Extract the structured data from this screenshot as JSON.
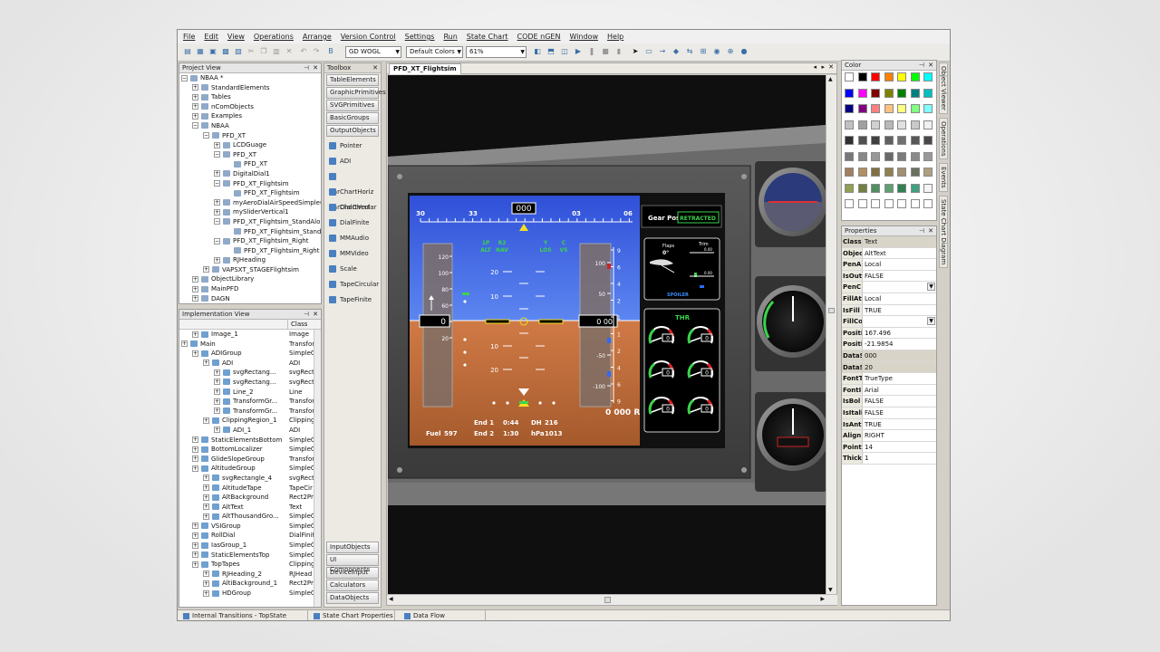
{
  "menu": [
    "File",
    "Edit",
    "View",
    "Operations",
    "Arrange",
    "Version Control",
    "Settings",
    "Run",
    "State Chart",
    "CODE nGEN",
    "Window",
    "Help"
  ],
  "toolbar": {
    "font_select": "GD WOGL",
    "colors_select": "Default Colors",
    "zoom_select": "61%"
  },
  "project_view": {
    "title": "Project View",
    "items": [
      {
        "label": "NBAA *",
        "indent": 0,
        "expander": "−"
      },
      {
        "label": "StandardElements",
        "indent": 1,
        "expander": "+"
      },
      {
        "label": "Tables",
        "indent": 1,
        "expander": "+"
      },
      {
        "label": "nComObjects",
        "indent": 1,
        "expander": "+"
      },
      {
        "label": "Examples",
        "indent": 1,
        "expander": "+"
      },
      {
        "label": "NBAA",
        "indent": 1,
        "expander": "−"
      },
      {
        "label": "PFD_XT",
        "indent": 2,
        "expander": "−"
      },
      {
        "label": "LCDGuage",
        "indent": 3,
        "expander": "+"
      },
      {
        "label": "PFD_XT",
        "indent": 3,
        "expander": "−"
      },
      {
        "label": "PFD_XT",
        "indent": 4,
        "expander": ""
      },
      {
        "label": "DigitalDial1",
        "indent": 3,
        "expander": "+"
      },
      {
        "label": "PFD_XT_Flightsim",
        "indent": 3,
        "expander": "−"
      },
      {
        "label": "PFD_XT_Flightsim",
        "indent": 4,
        "expander": ""
      },
      {
        "label": "myAeroDialAirSpeedSimple60",
        "indent": 3,
        "expander": "+"
      },
      {
        "label": "mySliderVertical1",
        "indent": 3,
        "expander": "+"
      },
      {
        "label": "PFD_XT_Flightsim_StandAlone",
        "indent": 3,
        "expander": "−"
      },
      {
        "label": "PFD_XT_Flightsim_Standalone",
        "indent": 4,
        "expander": ""
      },
      {
        "label": "PFD_XT_Flightsim_Right",
        "indent": 3,
        "expander": "−"
      },
      {
        "label": "PFD_XT_Flightsim_Right",
        "indent": 4,
        "expander": ""
      },
      {
        "label": "RJHeading",
        "indent": 3,
        "expander": "+"
      },
      {
        "label": "VAPSXT_STAGEFlightsim",
        "indent": 2,
        "expander": "+"
      },
      {
        "label": "ObjectLibrary",
        "indent": 1,
        "expander": "+"
      },
      {
        "label": "MainPFD",
        "indent": 1,
        "expander": "+"
      },
      {
        "label": "DAGN",
        "indent": 1,
        "expander": "+"
      }
    ]
  },
  "impl_view": {
    "title": "Implementation View",
    "class_header": "Class",
    "items": [
      {
        "label": "Image_1",
        "cls": "Image",
        "indent": 1
      },
      {
        "label": "Main",
        "cls": "Transfor",
        "indent": 0
      },
      {
        "label": "ADIGroup",
        "cls": "SimpleG",
        "indent": 1
      },
      {
        "label": "ADI",
        "cls": "ADI",
        "indent": 2
      },
      {
        "label": "svgRectang...",
        "cls": "svgRect",
        "indent": 3
      },
      {
        "label": "svgRectang...",
        "cls": "svgRect",
        "indent": 3
      },
      {
        "label": "Line_2",
        "cls": "Line",
        "indent": 3
      },
      {
        "label": "TransformGr...",
        "cls": "Transfor",
        "indent": 3
      },
      {
        "label": "TransformGr...",
        "cls": "Transfor",
        "indent": 3
      },
      {
        "label": "ClippingRegion_1",
        "cls": "Clipping",
        "indent": 2
      },
      {
        "label": "ADI_1",
        "cls": "ADI",
        "indent": 3
      },
      {
        "label": "StaticElementsBottom",
        "cls": "SimpleG",
        "indent": 1
      },
      {
        "label": "BottomLocalizer",
        "cls": "SimpleG",
        "indent": 1
      },
      {
        "label": "GlideSlopeGroup",
        "cls": "Transfor",
        "indent": 1
      },
      {
        "label": "AltitudeGroup",
        "cls": "SimpleG",
        "indent": 1
      },
      {
        "label": "svgRectangle_4",
        "cls": "svgRect",
        "indent": 2
      },
      {
        "label": "AltitudeTape",
        "cls": "TapeCir",
        "indent": 2
      },
      {
        "label": "AltBackground",
        "cls": "Rect2Pr",
        "indent": 2
      },
      {
        "label": "AltText",
        "cls": "Text",
        "indent": 2
      },
      {
        "label": "AltThousandGro...",
        "cls": "SimpleG",
        "indent": 2
      },
      {
        "label": "VSIGroup",
        "cls": "SimpleG",
        "indent": 1
      },
      {
        "label": "RollDial",
        "cls": "DialFinite",
        "indent": 1
      },
      {
        "label": "IasGroup_1",
        "cls": "SimpleG",
        "indent": 1
      },
      {
        "label": "StaticElementsTop",
        "cls": "SimpleG",
        "indent": 1
      },
      {
        "label": "TopTapes",
        "cls": "Clipping",
        "indent": 1
      },
      {
        "label": "RJHeading_2",
        "cls": "RJHead",
        "indent": 2
      },
      {
        "label": "AltiBackground_1",
        "cls": "Rect2Pr",
        "indent": 2
      },
      {
        "label": "HDGroup",
        "cls": "SimpleG",
        "indent": 2
      }
    ]
  },
  "toolbox": {
    "title": "Toolbox",
    "top_buttons": [
      "TableElements",
      "GraphicPrimitives",
      "SVGPrimitives",
      "BasicGroups",
      "OutputObjects"
    ],
    "items": [
      "Pointer",
      "ADI",
      "BarChartHoriz",
      "BarChartVert",
      "DialCircular",
      "DialFinite",
      "MMAudio",
      "MMVideo",
      "Scale",
      "TapeCircular",
      "TapeFinite"
    ],
    "bottom_buttons": [
      "InputObjects",
      "UI Components",
      "DeviceInput",
      "Calculators",
      "DataObjects"
    ]
  },
  "document": {
    "tab": "PFD_XT_Flightsim"
  },
  "pfd": {
    "heading_scale": [
      "30",
      "33",
      "000",
      "03",
      "06"
    ],
    "heading_value": "000",
    "fma": [
      {
        "top": "1P",
        "bottom": "ALT"
      },
      {
        "top": "R2",
        "bottom": "NAV"
      },
      {
        "top": "Y",
        "bottom": "LOS"
      },
      {
        "top": "C",
        "bottom": "VS"
      }
    ],
    "pitch_labels": [
      "20",
      "10",
      "10",
      "20"
    ],
    "speed_ticks": [
      "120",
      "100",
      "80",
      "60",
      "40",
      "20"
    ],
    "speed_value": "0",
    "alt_ticks": [
      "100",
      "50",
      "0",
      "-50",
      "-100"
    ],
    "alt_value": "0 00",
    "alt_bottom": "0 000 R",
    "vsi_labels": [
      "9",
      "6",
      "4",
      "2",
      "1",
      "1",
      "2",
      "4",
      "6",
      "9"
    ],
    "fuel_label": "Fuel",
    "fuel_value": "597",
    "end1_label": "End 1",
    "end1_time": "0:44",
    "end2_label": "End 2",
    "end2_time": "1:30",
    "dh_label": "DH",
    "dh_value": "216",
    "hpa_label": "hPa",
    "hpa_value": "1013",
    "gear_label": "Gear Pos",
    "gear_status": "RETRACTED",
    "flaps_label": "Flaps",
    "flaps_value": "0°",
    "trim_label": "Trim",
    "trim_top": "0.00",
    "trim_mid": "0.00",
    "spoiler_label": "SPOILER",
    "thr_label": "THR",
    "thr_gauges": [
      "0",
      "0",
      "0",
      "0",
      "0",
      "0"
    ]
  },
  "color_panel": {
    "title": "Color",
    "palette": [
      [
        "#ffffff",
        "#000000",
        "#ff0000",
        "#ff8000",
        "#ffff00",
        "#00ff00",
        "#00ffff"
      ],
      [
        "#0000ff",
        "#ff00ff",
        "#800000",
        "#808000",
        "#008000",
        "#008080",
        "#00c0c0"
      ],
      [
        "#000080",
        "#800080",
        "#ff8080",
        "#ffc080",
        "#ffff80",
        "#80ff80",
        "#80ffff"
      ],
      [
        "#c0c0c0",
        "#a0a0a0",
        "#d0d0d0",
        "#b8b8b8",
        "#e0e0e0",
        "#c8c8c8",
        "#f0f0f0"
      ],
      [
        "#303030",
        "#505050",
        "#404040",
        "#606060",
        "#707070",
        "#585858",
        "#484848"
      ],
      [
        "#787878",
        "#888888",
        "#989898",
        "#6a6a6a",
        "#7a7a7a",
        "#8a8a8a",
        "#9a9a9a"
      ],
      [
        "#a08060",
        "#b09060",
        "#807040",
        "#908050",
        "#a09070",
        "#6a7060",
        "#b0a080"
      ],
      [
        "#90a050",
        "#708040",
        "#509060",
        "#60a070",
        "#308050",
        "#40a080",
        "#f4f4f4"
      ],
      [
        "#ffffff",
        "#ffffff",
        "#ffffff",
        "#ffffff",
        "#ffffff",
        "#ffffff",
        "#ffffff"
      ]
    ]
  },
  "properties": {
    "title": "Properties",
    "rows": [
      {
        "k": "Class",
        "v": "Text",
        "hl": true
      },
      {
        "k": "Object",
        "v": "AltText",
        "hl": false
      },
      {
        "k": "PenA",
        "v": "Local",
        "hl": false
      },
      {
        "k": "IsOut",
        "v": "FALSE",
        "hl": false
      },
      {
        "k": "PenC",
        "v": "",
        "hl": false
      },
      {
        "k": "FillAtt",
        "v": "Local",
        "hl": false
      },
      {
        "k": "IsFill",
        "v": "TRUE",
        "hl": false
      },
      {
        "k": "FillCo",
        "v": "",
        "hl": false
      },
      {
        "k": "Positi",
        "v": "167.496",
        "hl": false
      },
      {
        "k": "Positi",
        "v": "-21.9854",
        "hl": false
      },
      {
        "k": "DataS",
        "v": "000",
        "hl": true
      },
      {
        "k": "DataS",
        "v": "20",
        "hl": true
      },
      {
        "k": "FontT",
        "v": "TrueType",
        "hl": false
      },
      {
        "k": "FontI",
        "v": "Arial",
        "hl": false
      },
      {
        "k": "IsBol",
        "v": "FALSE",
        "hl": false
      },
      {
        "k": "IsItali",
        "v": "FALSE",
        "hl": false
      },
      {
        "k": "IsAnt",
        "v": "TRUE",
        "hl": false
      },
      {
        "k": "Align",
        "v": "RIGHT",
        "hl": false
      },
      {
        "k": "Point",
        "v": "14",
        "hl": false
      },
      {
        "k": "Thick",
        "v": "1",
        "hl": false
      }
    ]
  },
  "side_tabs": [
    "Object Viewer",
    "Operations",
    "Events",
    "State Chart Diagram"
  ],
  "bottom_tabs": [
    "Internal Transitions - TopState",
    "State Chart Properties",
    "Data Flow"
  ]
}
